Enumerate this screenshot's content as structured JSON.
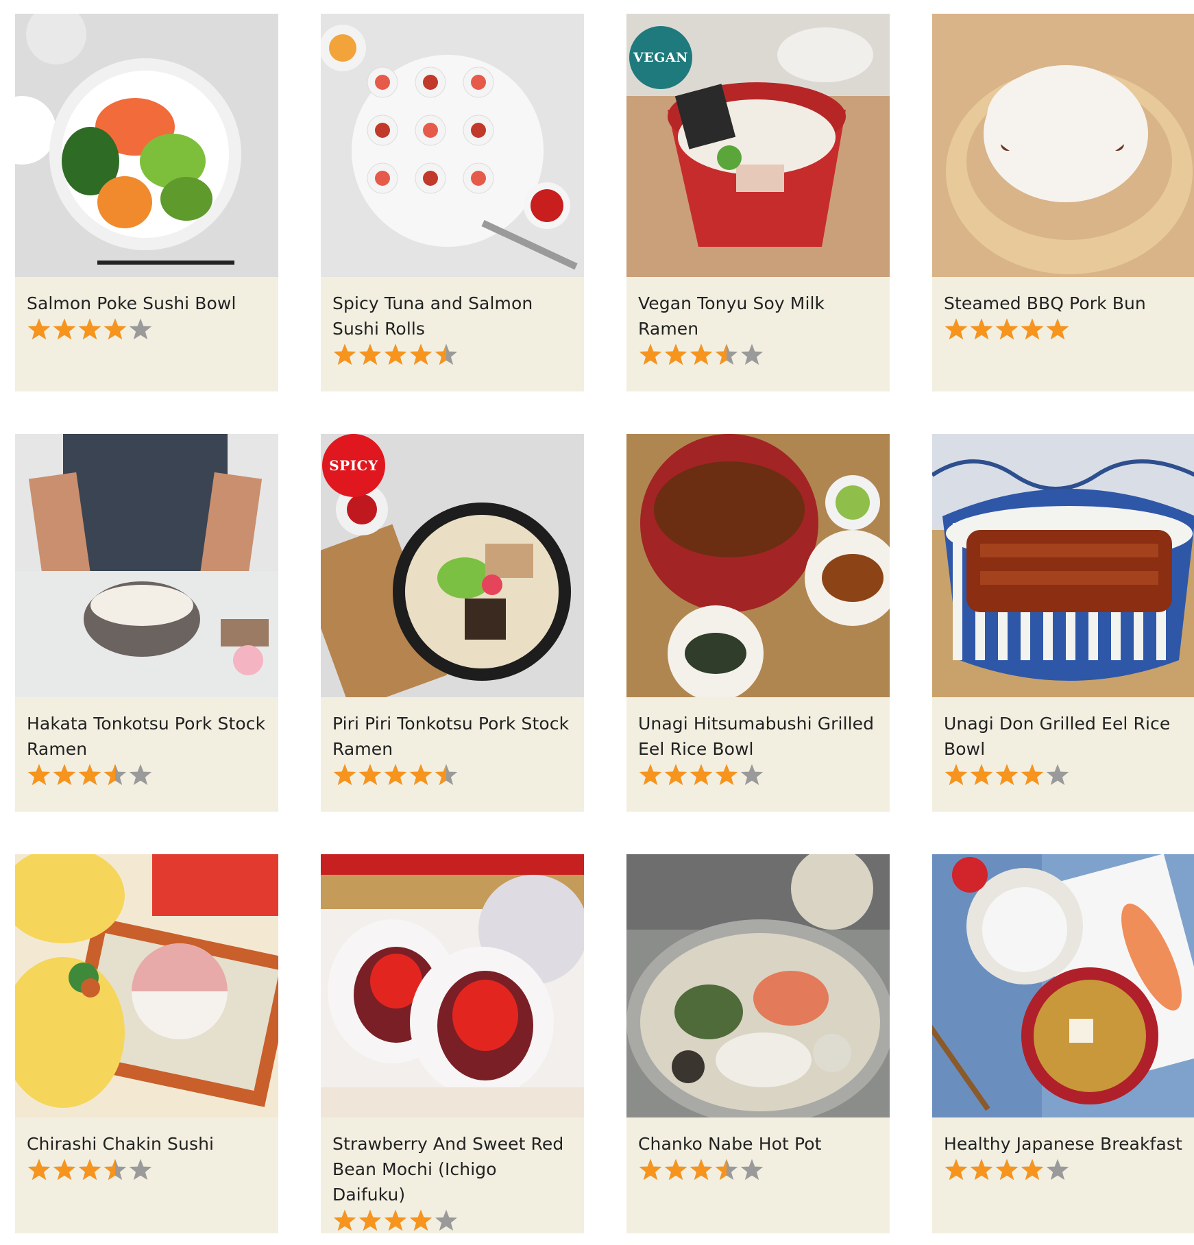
{
  "colors": {
    "card_background": "#f2efe1",
    "star_filled": "#f7941d",
    "star_empty": "#9a9a9a",
    "vegan_badge": "#1e7a7c",
    "spicy_badge": "#e0171e"
  },
  "recipes": [
    {
      "title": "Salmon Poke Sushi Bowl",
      "rating": 4,
      "badge": null,
      "photo_icon": "poke-bowl-photo",
      "photo_colors": [
        "#dcdcdc",
        "#ffffff",
        "#f26b3a",
        "#7dbf3b",
        "#2e6b25",
        "#f08a2c"
      ]
    },
    {
      "title": "Spicy Tuna and Salmon Sushi Rolls",
      "rating": 4.5,
      "badge": null,
      "photo_icon": "sushi-rolls-photo",
      "photo_colors": [
        "#e4e4e4",
        "#f7f7f7",
        "#c0392b",
        "#2b2b2b",
        "#f2a33a",
        "#d9d9d9"
      ]
    },
    {
      "title": "Vegan Tonyu Soy Milk Ramen",
      "rating": 3.5,
      "badge": "VEGAN",
      "photo_icon": "ramen-bowl-photo",
      "photo_colors": [
        "#c9a07a",
        "#d8dde0",
        "#c72c2c",
        "#f2ede4",
        "#2a2a2a",
        "#5aa63a"
      ]
    },
    {
      "title": "Steamed BBQ Pork Bun",
      "rating": 5,
      "badge": null,
      "photo_icon": "pork-bun-photo",
      "photo_colors": [
        "#d9b488",
        "#e8c99a",
        "#f6f3ee",
        "#7ab648",
        "#6b3a24",
        "#b88a5a"
      ]
    },
    {
      "title": "Hakata Tonkotsu Pork Stock Ramen",
      "rating": 3.5,
      "badge": null,
      "photo_icon": "chef-ramen-photo",
      "photo_colors": [
        "#3a4452",
        "#e8eaea",
        "#c98f6e",
        "#6b6360",
        "#f3efe6",
        "#9b7b63"
      ]
    },
    {
      "title": "Piri Piri Tonkotsu Pork Stock Ramen",
      "rating": 4.5,
      "badge": "SPICY",
      "photo_icon": "spicy-ramen-photo",
      "photo_colors": [
        "#dcdcdc",
        "#b5844f",
        "#1d1d1d",
        "#eadfc4",
        "#7cc043",
        "#e6445a"
      ]
    },
    {
      "title": "Unagi Hitsumabushi Grilled Eel Rice Bowl",
      "rating": 4,
      "badge": null,
      "photo_icon": "hitsumabushi-photo",
      "photo_colors": [
        "#b08650",
        "#a32424",
        "#6b2e12",
        "#f4f1ea",
        "#8fbf4a",
        "#2f3d2a"
      ]
    },
    {
      "title": "Unagi Don Grilled Eel Rice Bowl",
      "rating": 4,
      "badge": null,
      "photo_icon": "unagi-don-photo",
      "photo_colors": [
        "#c8a26a",
        "#2f57a8",
        "#f3f3f0",
        "#8b2e12",
        "#3d7a2a",
        "#e9e2d2"
      ]
    },
    {
      "title": "Chirashi Chakin Sushi",
      "rating": 3.5,
      "badge": null,
      "photo_icon": "chakin-sushi-photo",
      "photo_colors": [
        "#f3e9d3",
        "#f5d65a",
        "#e8a9a9",
        "#c95f2a",
        "#3f8a3a",
        "#e33a2f"
      ]
    },
    {
      "title": "Strawberry And Sweet Red Bean Mochi (Ichigo Daifuku)",
      "rating": 4,
      "badge": null,
      "photo_icon": "mochi-photo",
      "photo_colors": [
        "#f2efec",
        "#e2261f",
        "#7a1f26",
        "#dedbe2",
        "#c59b5a",
        "#f7f5f5"
      ]
    },
    {
      "title": "Chanko Nabe Hot Pot",
      "rating": 3.5,
      "badge": null,
      "photo_icon": "hot-pot-photo",
      "photo_colors": [
        "#8b8d8b",
        "#d9d4c4",
        "#e37a5a",
        "#4f6b3a",
        "#3b3530",
        "#f0ede6"
      ]
    },
    {
      "title": "Healthy Japanese Breakfast",
      "rating": 4,
      "badge": null,
      "photo_icon": "breakfast-photo",
      "photo_colors": [
        "#6a8fbf",
        "#f6f6f6",
        "#f08e5a",
        "#b0202a",
        "#c8983a",
        "#e8e3da"
      ]
    }
  ]
}
